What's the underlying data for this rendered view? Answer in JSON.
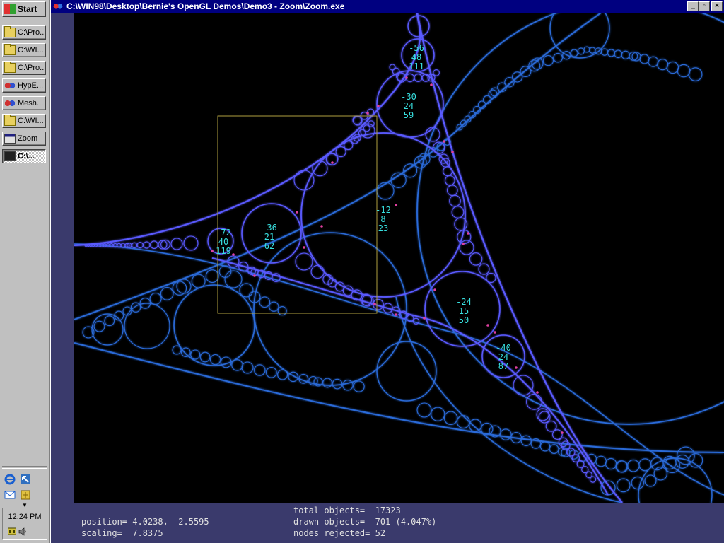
{
  "taskbar": {
    "start_label": "Start",
    "items": [
      {
        "label": "C:\\Pro...",
        "icon": "folder-icon"
      },
      {
        "label": "C:\\WI...",
        "icon": "folder-icon"
      },
      {
        "label": "C:\\Pro...",
        "icon": "folder-icon"
      },
      {
        "label": "HypE...",
        "icon": "opengl-app-icon"
      },
      {
        "label": "Mesh...",
        "icon": "opengl-app-icon"
      },
      {
        "label": "C:\\WI...",
        "icon": "folder-icon"
      },
      {
        "label": "Zoom",
        "icon": "zoom-app-icon"
      },
      {
        "label": "C:\\...",
        "icon": "console-icon",
        "active": true
      }
    ],
    "clock": "12:24 PM"
  },
  "window": {
    "title": "C:\\WIN98\\Desktop\\Bernie's OpenGL Demos\\Demo3 - Zoom\\Zoom.exe",
    "minimize_label": "_",
    "maximize_label": "▫",
    "close_label": "×"
  },
  "scene": {
    "circle_labels": [
      {
        "lines": [
          "-56",
          "48",
          "111"
        ]
      },
      {
        "lines": [
          "-30",
          "24",
          "59"
        ]
      },
      {
        "lines": [
          "-12",
          "8",
          "23"
        ]
      },
      {
        "lines": [
          "-36",
          "21",
          "62"
        ]
      },
      {
        "lines": [
          "-72",
          "40",
          "119"
        ]
      },
      {
        "lines": [
          "-24",
          "15",
          "50"
        ]
      },
      {
        "lines": [
          "-40",
          "24",
          "87"
        ]
      }
    ]
  },
  "status": {
    "position_label": "position=",
    "position_value": "4.0238, -2.5595",
    "scaling_label": "scaling=",
    "scaling_value": "7.8375",
    "total_objects_label": "total objects=",
    "total_objects_value": "17323",
    "drawn_objects_label": "drawn objects=",
    "drawn_objects_value": "701 (4.047%)",
    "nodes_rejected_label": "nodes rejected=",
    "nodes_rejected_value": "52"
  },
  "colors": {
    "bright_curve": "#5a5aff",
    "dim_curve": "#2a6ad8",
    "label": "#38e0e0",
    "zoom_rect": "#b0a040",
    "status_bg": "#3a3a6c"
  }
}
